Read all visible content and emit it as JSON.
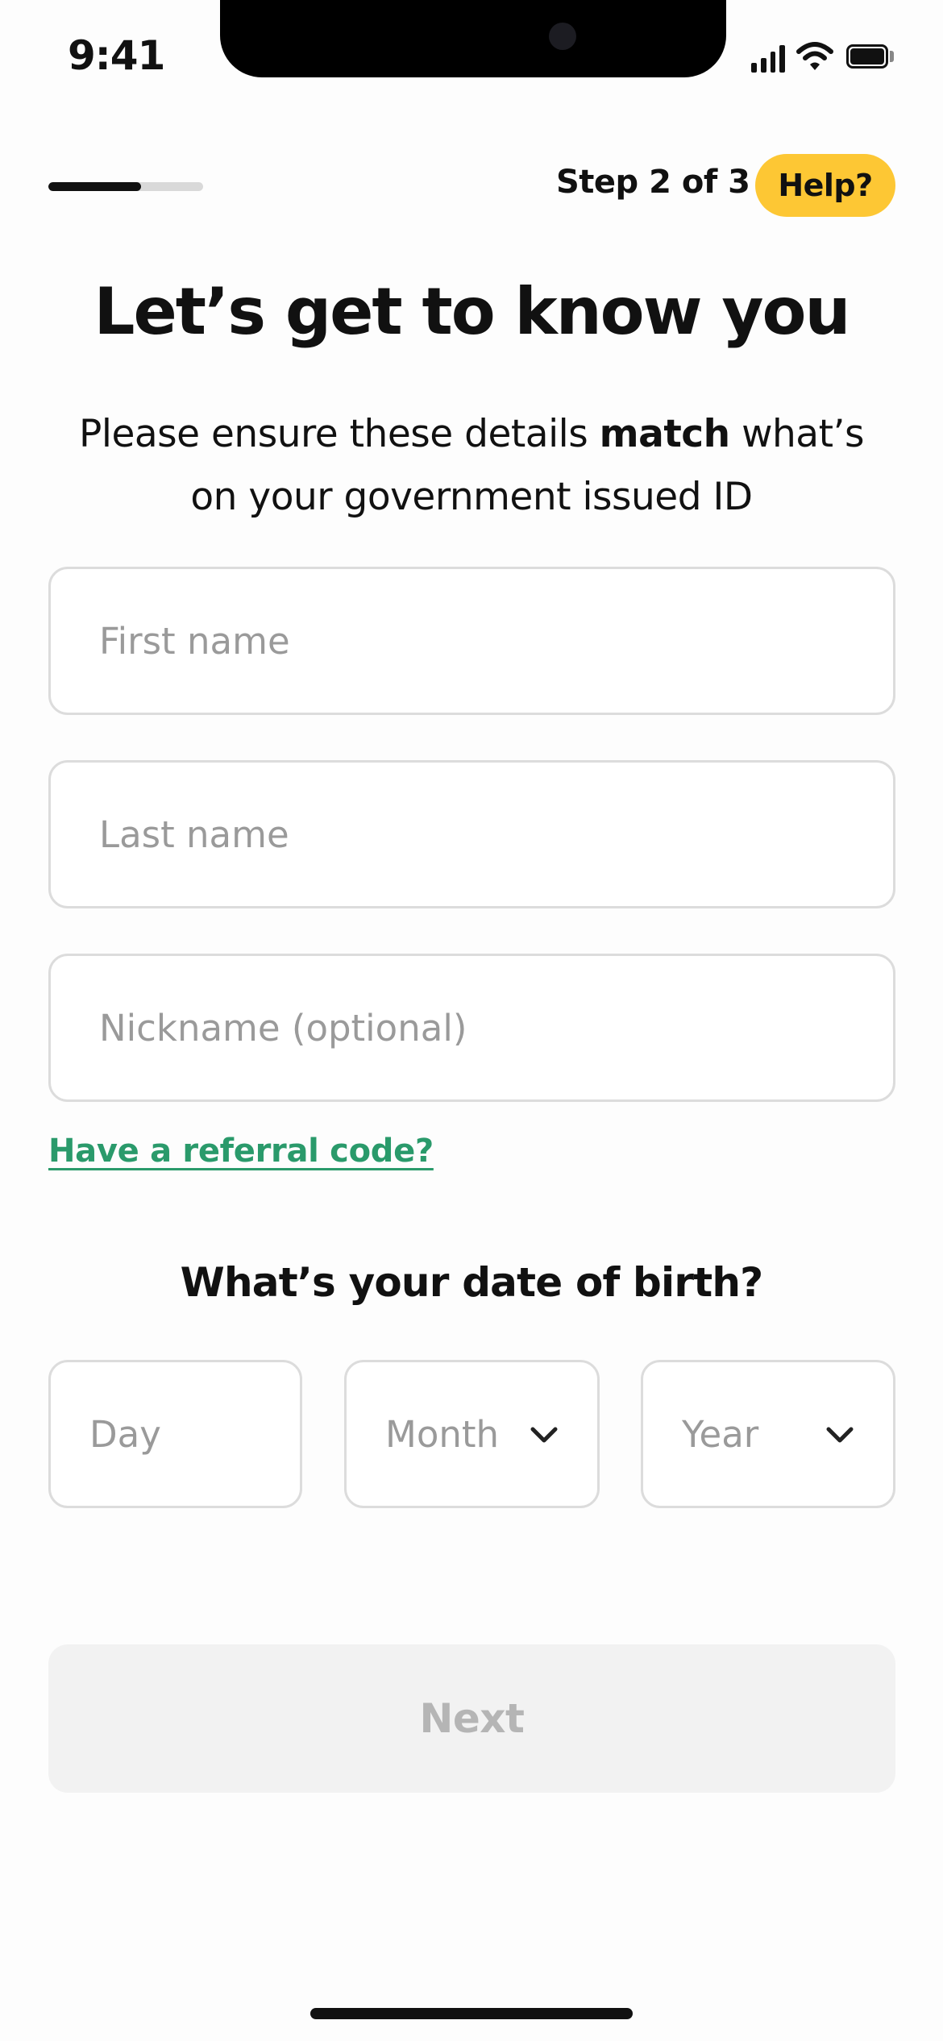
{
  "status_bar": {
    "time": "9:41"
  },
  "progress": {
    "fraction": 0.6,
    "step_label": "Step 2 of 3"
  },
  "help_button": {
    "label": "Help?"
  },
  "title": "Let’s get to know you",
  "subtitle": {
    "before": "Please ensure these details ",
    "bold": "match",
    "after": " what’s on your government issued ID"
  },
  "fields": {
    "first_name": {
      "placeholder": "First name",
      "value": ""
    },
    "last_name": {
      "placeholder": "Last name",
      "value": ""
    },
    "nickname": {
      "placeholder": "Nickname (optional)",
      "value": ""
    }
  },
  "referral_link": "Have a referral code?",
  "dob": {
    "title": "What’s your date of birth?",
    "day_placeholder": "Day",
    "month_label": "Month",
    "year_label": "Year"
  },
  "next_button": {
    "label": "Next",
    "enabled": false
  },
  "colors": {
    "accent_yellow": "#FDC734",
    "link_green": "#2A9A6B",
    "disabled_bg": "#F2F2F2"
  }
}
